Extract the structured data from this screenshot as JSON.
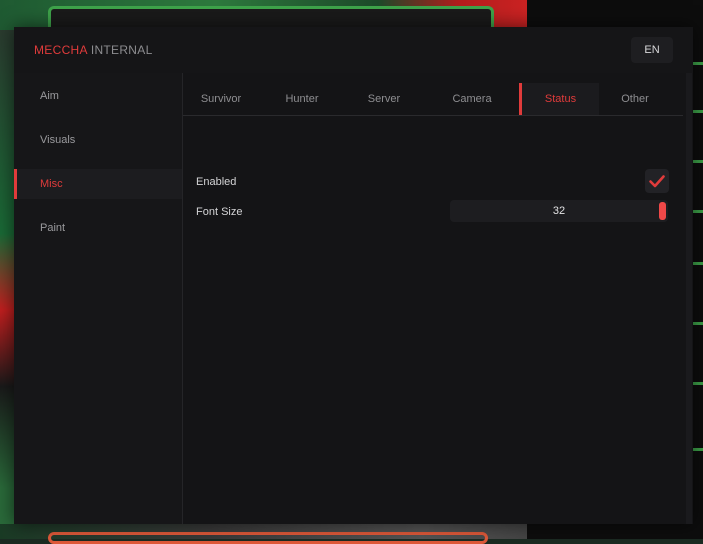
{
  "window": {
    "brand_main": "MECCHA",
    "brand_sub": "INTERNAL",
    "language": "EN"
  },
  "sidebar": {
    "items": [
      {
        "label": "Aim",
        "active": false
      },
      {
        "label": "Visuals",
        "active": false
      },
      {
        "label": "Misc",
        "active": true
      },
      {
        "label": "Paint",
        "active": false
      }
    ]
  },
  "tabs": [
    {
      "label": "Survivor",
      "active": false
    },
    {
      "label": "Hunter",
      "active": false
    },
    {
      "label": "Server",
      "active": false
    },
    {
      "label": "Camera",
      "active": false
    },
    {
      "label": "Status",
      "active": true
    },
    {
      "label": "Other",
      "active": false
    }
  ],
  "settings": {
    "enabled": {
      "label": "Enabled",
      "checked": true
    },
    "font_size": {
      "label": "Font Size",
      "value": "32",
      "fill_fraction": 1.0
    }
  },
  "colors": {
    "accent": "#e03b3b",
    "window_bg": "#141416",
    "sidebar_bg": "#161618",
    "text_muted": "#9a9a9d"
  },
  "icons": {
    "checkmark": "checkmark-icon"
  }
}
